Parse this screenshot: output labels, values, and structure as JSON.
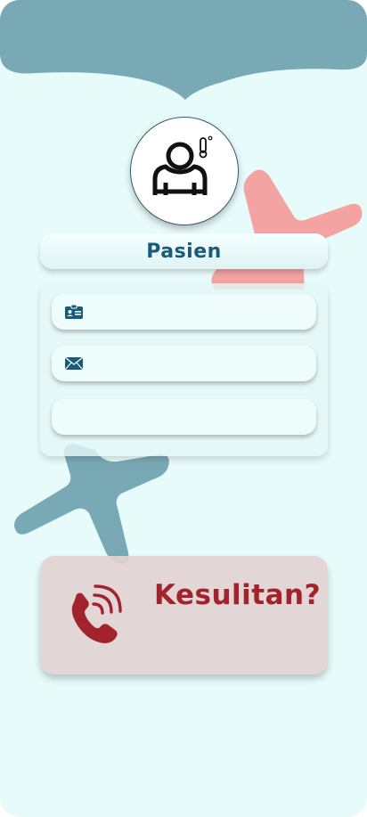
{
  "header": {
    "accent_color": "#7aa9b6"
  },
  "avatar": {
    "icon": "patient-thermometer-icon"
  },
  "title": {
    "text": "Pasien"
  },
  "form": {
    "fields": [
      {
        "icon": "id-card-icon",
        "value": "",
        "placeholder": ""
      },
      {
        "icon": "envelope-icon",
        "value": "",
        "placeholder": ""
      },
      {
        "icon": "",
        "value": "",
        "placeholder": ""
      }
    ]
  },
  "help": {
    "label": "Kesulitan?",
    "icon": "phone-call-icon",
    "color": "#a3232c"
  },
  "colors": {
    "background": "#e8fbfb",
    "primary": "#1b5a78",
    "star_red": "#f3a3a2",
    "star_blue": "#7aa9b6"
  }
}
